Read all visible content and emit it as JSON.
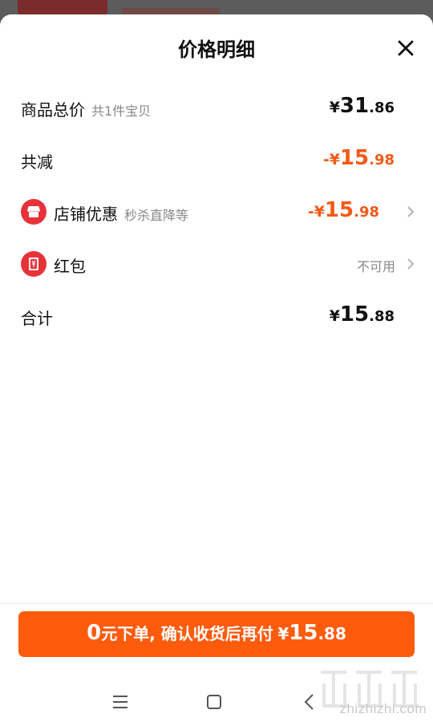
{
  "sheet": {
    "title": "价格明细"
  },
  "rows": {
    "total": {
      "label": "商品总价",
      "sub": "共1件宝贝",
      "currency": "¥",
      "int": "31",
      "dec": ".86"
    },
    "reduced": {
      "label": "共减",
      "currency": "-¥",
      "int": "15",
      "dec": ".98"
    },
    "shop_discount": {
      "label": "店铺优惠",
      "sub": "秒杀直降等",
      "currency": "-¥",
      "int": "15",
      "dec": ".98"
    },
    "red_packet": {
      "label": "红包",
      "status": "不可用"
    },
    "sum": {
      "label": "合计",
      "currency": "¥",
      "int": "15",
      "dec": ".88"
    }
  },
  "order_button": {
    "zero": "0",
    "text": "元下单, 确认收货后再付",
    "currency": "¥",
    "int": "15",
    "dec": ".88"
  },
  "watermark": {
    "url": "zhizhizhi.com"
  },
  "colors": {
    "accent": "#ff5b0d",
    "discount": "#f35a16",
    "icon_red": "#e8323a"
  },
  "icons": [
    "close-icon",
    "shop-icon",
    "red-packet-icon",
    "chevron-right-icon",
    "menu-icon",
    "home-icon",
    "back-icon"
  ]
}
